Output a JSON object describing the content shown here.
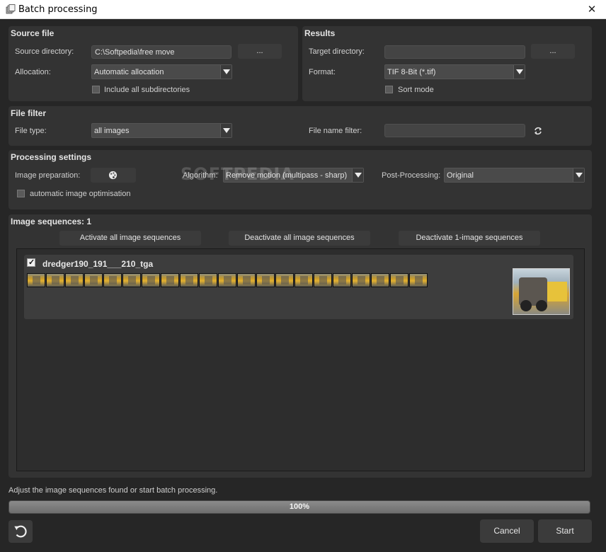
{
  "window": {
    "title": "Batch processing",
    "close_glyph": "✕"
  },
  "source_file": {
    "title": "Source file",
    "directory_label": "Source directory:",
    "directory_value": "C:\\Softpedia\\free move",
    "browse_label": "...",
    "allocation_label": "Allocation:",
    "allocation_value": "Automatic allocation",
    "include_subdirs_label": "Include all subdirectories",
    "include_subdirs_checked": false
  },
  "results": {
    "title": "Results",
    "target_label": "Target directory:",
    "target_value": "",
    "browse_label": "...",
    "format_label": "Format:",
    "format_value": "TIF 8-Bit (*.tif)",
    "sort_mode_label": "Sort mode",
    "sort_mode_checked": false
  },
  "file_filter": {
    "title": "File filter",
    "file_type_label": "File type:",
    "file_type_value": "all images",
    "name_filter_label": "File name filter:",
    "name_filter_value": ""
  },
  "processing": {
    "title": "Processing settings",
    "image_prep_label": "Image preparation:",
    "algorithm_label": "Algorithm:",
    "algorithm_value": "Remove motion (multipass - sharp)",
    "post_label": "Post-Processing:",
    "post_value": "Original",
    "auto_opt_label": "automatic image optimisation",
    "auto_opt_checked": false
  },
  "sequences": {
    "title": "Image sequences: 1",
    "activate_all": "Activate all image sequences",
    "deactivate_all": "Deactivate all image sequences",
    "deactivate_single": "Deactivate 1-image sequences",
    "items": [
      {
        "name": "dredger190_191___210_tga",
        "checked": true,
        "check_glyph": "✓",
        "thumbnail_count": 21
      }
    ]
  },
  "footer": {
    "status": "Adjust the image sequences found or start batch processing.",
    "progress_percent": 100,
    "progress_text": "100%",
    "cancel_label": "Cancel",
    "start_label": "Start"
  },
  "watermark": "SOFTPEDIA",
  "icons": {
    "app": "batch-icon",
    "refresh": "refresh-icon",
    "image_prep": "palette-icon",
    "undo": "undo-icon"
  },
  "colors": {
    "background": "#262626",
    "panel": "#333333",
    "field": "#444444",
    "progress_fill": "#7d7d7d"
  }
}
